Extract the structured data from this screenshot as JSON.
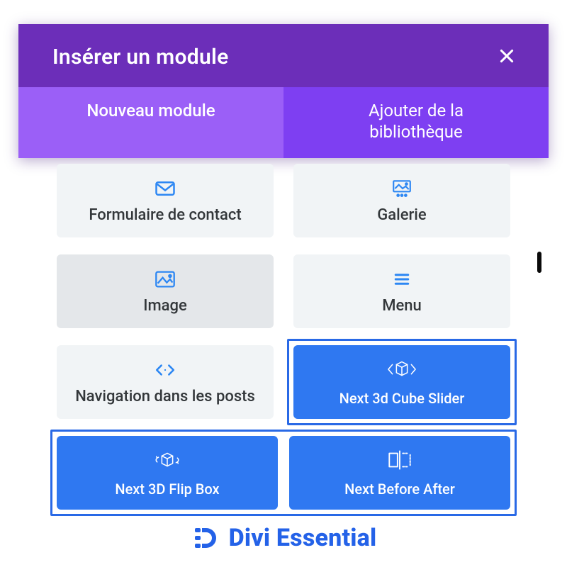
{
  "modal": {
    "title": "Insérer un module",
    "tabs": [
      {
        "label": "Nouveau module",
        "active": true
      },
      {
        "label": "Ajouter de la\nbibliothèque",
        "active": false
      }
    ]
  },
  "modules": {
    "standard": [
      {
        "id": "contact-form",
        "label": "Formulaire de contact",
        "icon": "mail"
      },
      {
        "id": "gallery",
        "label": "Galerie",
        "icon": "gallery"
      },
      {
        "id": "image",
        "label": "Image",
        "icon": "image"
      },
      {
        "id": "menu",
        "label": "Menu",
        "icon": "menu"
      },
      {
        "id": "post-nav",
        "label": "Navigation dans les posts",
        "icon": "code"
      }
    ],
    "highlighted": [
      {
        "id": "next-3d-cube",
        "label": "Next 3d Cube Slider",
        "icon": "cube-code"
      },
      {
        "id": "next-3d-flip",
        "label": "Next 3D Flip Box",
        "icon": "cube-rotate"
      },
      {
        "id": "next-before-after",
        "label": "Next Before After",
        "icon": "before-after"
      }
    ]
  },
  "brand": {
    "name": "Divi Essential"
  },
  "colors": {
    "header": "#6c2eb9",
    "tabs_bg": "#7e3ff2",
    "tab_active": "#9b5ff7",
    "card_bg": "#f1f4f6",
    "card_hover": "#e4e7ea",
    "accent_blue": "#2f78f1",
    "outline_blue": "#2969e6",
    "icon_blue": "#2d87f3",
    "brand_blue": "#2462e8"
  }
}
